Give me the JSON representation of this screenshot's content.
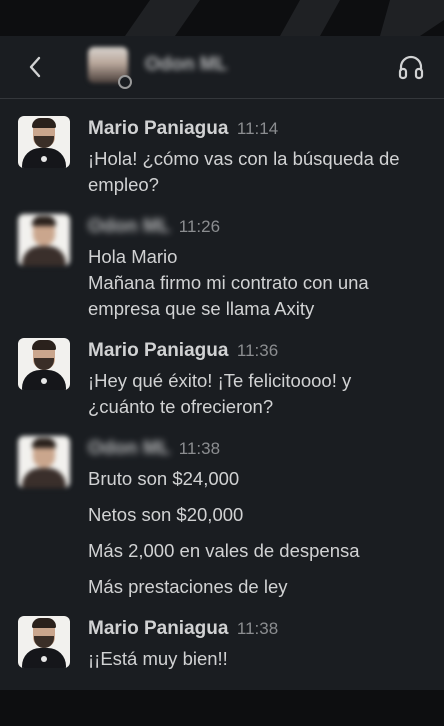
{
  "header": {
    "back_icon": "chevron-left-icon",
    "contact_name": "Odon ML",
    "headset_icon": "headphones-icon"
  },
  "messages": [
    {
      "sender": "Mario Paniagua",
      "time": "11:14",
      "lines": [
        "¡Hola! ¿cómo vas con la búsqueda de",
        "empleo?"
      ]
    },
    {
      "sender": "Odon ML",
      "time": "11:26",
      "lines": [
        "Hola Mario",
        "Mañana firmo mi contrato con una",
        "empresa que se llama Axity"
      ]
    },
    {
      "sender": "Mario Paniagua",
      "time": "11:36",
      "lines": [
        "¡Hey qué éxito! ¡Te felicitoooo! y",
        "¿cuánto te ofrecieron?"
      ]
    },
    {
      "sender": "Odon ML",
      "time": "11:38",
      "lines": [
        "Bruto son $24,000",
        "Netos son $20,000",
        "Más 2,000 en vales de despensa",
        "Más prestaciones de ley"
      ]
    },
    {
      "sender": "Mario Paniagua",
      "time": "11:38",
      "lines": [
        "¡¡Está muy bien!!"
      ]
    }
  ]
}
